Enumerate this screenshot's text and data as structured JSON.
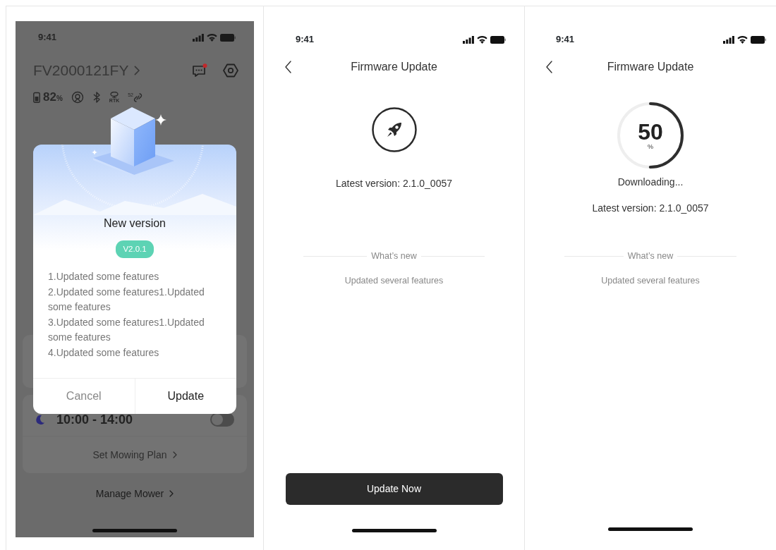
{
  "home_screen": {
    "status_bar": {
      "time": "9:41"
    },
    "device_name": "FV2000121FY",
    "has_unread_messages": true,
    "battery": {
      "percent": "82",
      "unit": "%"
    },
    "rtk_label": "RTK",
    "satellite_count": "52",
    "schedule": {
      "time": "10:00 - 14:00",
      "enabled": false
    },
    "plan_link": "Set Mowing Plan",
    "manage_link": "Manage Mower",
    "dialog": {
      "title": "New version",
      "version_badge": "V2.0.1",
      "notes": [
        "1.Updated some features",
        "2.Updated some features1.Updated some features",
        "3.Updated some features1.Updated some features",
        "4.Updated some features"
      ],
      "buttons": [
        {
          "label": "Cancel",
          "primary": false
        },
        {
          "label": "Update",
          "primary": true
        }
      ]
    }
  },
  "firmware_screen": {
    "status_bar": {
      "time": "9:41"
    },
    "title": "Firmware Update",
    "latest_version": "Latest version: 2.1.0_0057",
    "whats_new_heading": "What’s new",
    "whats_new_text": "Updated several features",
    "update_button": "Update Now"
  },
  "downloading_screen": {
    "status_bar": {
      "time": "9:41"
    },
    "title": "Firmware Update",
    "progress": {
      "value": "50",
      "unit": "%",
      "level": 0.5
    },
    "status": "Downloading...",
    "latest_version": "Latest version: 2.1.0_0057",
    "whats_new_heading": "What’s new",
    "whats_new_text": "Updated several features"
  }
}
